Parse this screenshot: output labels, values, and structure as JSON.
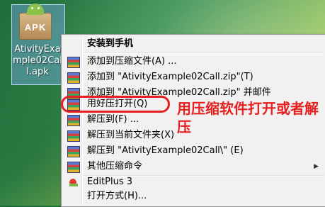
{
  "desktop": {
    "icon_badge": "APK",
    "icon_caption": "AtivityExample02Call.apk"
  },
  "context_menu": {
    "items": [
      {
        "label": "安装到手机",
        "icon": "none",
        "bold": true
      },
      {
        "label": "添加到压缩文件(A) ...",
        "icon": "winrar-icon"
      },
      {
        "label": "添加到 \"AtivityExample02Call.zip\"(T)",
        "icon": "winrar-icon"
      },
      {
        "label": "添加到 \"AtivityExample02Call.zip\" 并邮件",
        "icon": "winrar-icon"
      },
      {
        "label": "用好压打开(Q)",
        "icon": "winrar-icon"
      },
      {
        "label": "解压到(F) ...",
        "icon": "winrar-icon"
      },
      {
        "label": "解压到当前文件夹(X)",
        "icon": "winrar-icon"
      },
      {
        "label": "解压到 \"AtivityExample02Call\\\" (E)",
        "icon": "winrar-icon"
      },
      {
        "label": "其他压缩命令",
        "icon": "winrar-icon",
        "submenu": true
      },
      {
        "label": "EditPlus 3",
        "icon": "editplus-icon"
      },
      {
        "label": "打开方式(H)...",
        "icon": "none"
      }
    ]
  },
  "annotation": {
    "text": "用压缩软件打开或者解压",
    "color": "#e62020"
  }
}
